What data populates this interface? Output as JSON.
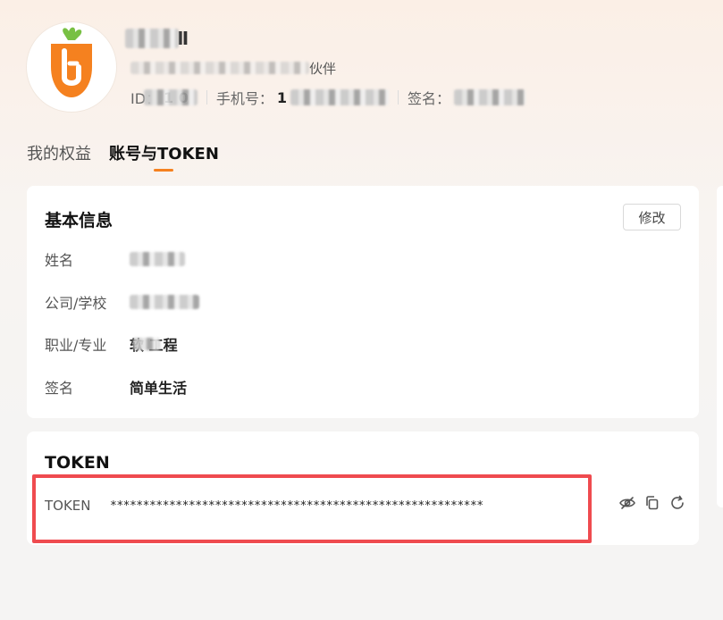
{
  "profile": {
    "name_tail": "Ⅱ",
    "desc_tail": "伙伴",
    "id_label": "ID：",
    "id_value": "1   0",
    "phone_label": "手机号：",
    "phone_value": "1",
    "sign_label": "签名："
  },
  "tabs": [
    {
      "label": "我的权益"
    },
    {
      "label": "账号与TOKEN"
    }
  ],
  "basic": {
    "title": "基本信息",
    "edit_label": "修改",
    "rows": [
      {
        "key": "姓名",
        "value": ""
      },
      {
        "key": "公司/学校",
        "value": ""
      },
      {
        "key": "职业/专业",
        "value": "软   工程"
      },
      {
        "key": "签名",
        "value": "简单生活"
      }
    ]
  },
  "token": {
    "title": "TOKEN",
    "label": "TOKEN",
    "value": "*********************************************************",
    "icons": [
      "eye-off-icon",
      "copy-icon",
      "refresh-icon"
    ]
  },
  "colors": {
    "accent": "#f5811f",
    "highlight": "#ef4b4f",
    "carrot": "#f5811f",
    "leaf": "#78c043"
  }
}
